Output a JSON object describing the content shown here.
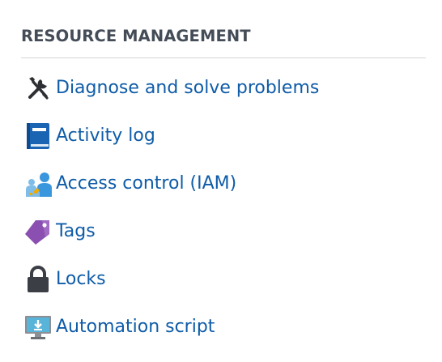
{
  "section": {
    "title": "RESOURCE MANAGEMENT"
  },
  "menu": {
    "items": [
      {
        "label": "Diagnose and solve problems",
        "icon": "wrench-screwdriver-icon"
      },
      {
        "label": "Activity log",
        "icon": "book-icon"
      },
      {
        "label": "Access control (IAM)",
        "icon": "users-icon"
      },
      {
        "label": "Tags",
        "icon": "tag-icon"
      },
      {
        "label": "Locks",
        "icon": "lock-icon"
      },
      {
        "label": "Automation script",
        "icon": "monitor-download-icon"
      }
    ]
  },
  "colors": {
    "link": "#0f5ca8",
    "heading": "#444c57",
    "divider": "#d6d6d6",
    "tag_purple": "#8a4fb0",
    "access_blue": "#3a96dd",
    "lock_dark": "#3b3e45"
  }
}
